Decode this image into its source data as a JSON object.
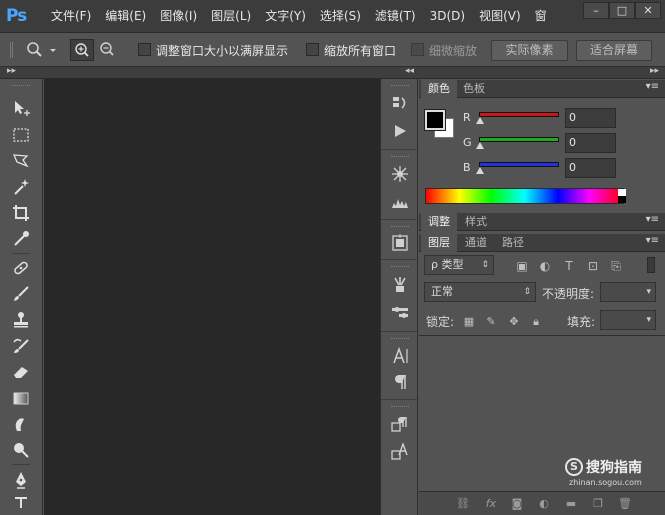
{
  "app": {
    "logo_text": "Ps"
  },
  "menu": {
    "items": [
      "文件(F)",
      "编辑(E)",
      "图像(I)",
      "图层(L)",
      "文字(Y)",
      "选择(S)",
      "滤镜(T)",
      "3D(D)",
      "视图(V)",
      "窗"
    ]
  },
  "window_controls": {
    "minimize": "–",
    "maximize": "□",
    "close": "✕"
  },
  "options_bar": {
    "resize_windows_label": "调整窗口大小以满屏显示",
    "zoom_all_label": "缩放所有窗口",
    "scrubby_zoom_label": "细微缩放",
    "actual_pixels_label": "实际像素",
    "fit_screen_label": "适合屏幕"
  },
  "color_panel": {
    "tabs": [
      "颜色",
      "色板"
    ],
    "channels": [
      {
        "label": "R",
        "value": "0",
        "color": "#d01818"
      },
      {
        "label": "G",
        "value": "0",
        "color": "#22b022"
      },
      {
        "label": "B",
        "value": "0",
        "color": "#2233dd"
      }
    ],
    "foreground": "#000000",
    "background": "#ffffff"
  },
  "adjust_panel": {
    "tabs": [
      "调整",
      "样式"
    ]
  },
  "layers_panel": {
    "tabs": [
      "图层",
      "通道",
      "路径"
    ],
    "filter_label": "ρ 类型",
    "blend_mode": "正常",
    "opacity_label": "不透明度:",
    "lock_label": "锁定:",
    "fill_label": "填充:"
  },
  "watermark": {
    "logo_glyph": "S",
    "text": "搜狗指南",
    "url": "zhinan.sogou.com"
  }
}
